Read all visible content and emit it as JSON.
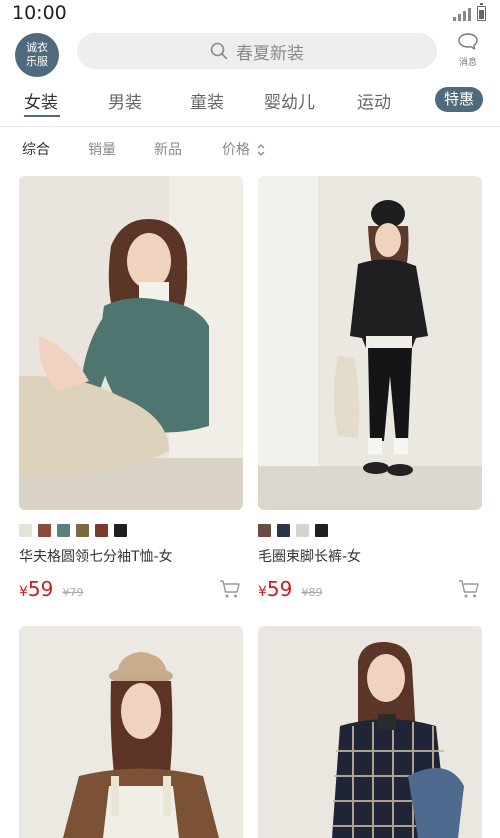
{
  "status": {
    "time": "10:00"
  },
  "header": {
    "logo_line1": "诚衣",
    "logo_line2": "乐服",
    "search_placeholder": "春夏新装",
    "message_label": "消息"
  },
  "tabs": [
    {
      "label": "女装",
      "active": true
    },
    {
      "label": "男装"
    },
    {
      "label": "童装"
    },
    {
      "label": "婴幼儿"
    },
    {
      "label": "运动"
    },
    {
      "label": "特惠",
      "highlight": true
    }
  ],
  "sort": [
    {
      "label": "综合",
      "active": true
    },
    {
      "label": "销量"
    },
    {
      "label": "新品"
    },
    {
      "label": "价格"
    }
  ],
  "products": [
    {
      "name": "华夫格圆领七分袖T恤-女",
      "price_symbol": "¥",
      "price": "59",
      "old_price": "¥79",
      "swatches": [
        "#e6e2d6",
        "#8b4a3a",
        "#5d7f7d",
        "#7b6a3e",
        "#7a3a2c",
        "#1f1f1f"
      ]
    },
    {
      "name": "毛圈束脚长裤-女",
      "price_symbol": "¥",
      "price": "59",
      "old_price": "¥89",
      "swatches": [
        "#6b4a42",
        "#2a3547",
        "#d6d4cf",
        "#1f1f1f"
      ]
    },
    {
      "name": "",
      "swatches": []
    },
    {
      "name": "",
      "swatches": []
    }
  ],
  "colors": {
    "accent": "#4f6a7d",
    "price": "#c8202b"
  }
}
